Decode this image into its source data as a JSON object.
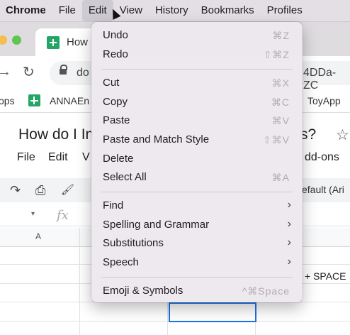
{
  "menubar": {
    "items": [
      "Chrome",
      "File",
      "Edit",
      "View",
      "History",
      "Bookmarks",
      "Profiles"
    ]
  },
  "browser": {
    "tab_title": "How",
    "url_left": "do",
    "url_right": "4DDa-ZC"
  },
  "bookmarks": {
    "items": [
      "ops",
      "ANNAEn",
      "ToyApp"
    ]
  },
  "document": {
    "title_left": "How do I In",
    "title_right": "s?",
    "menu": [
      "File",
      "Edit",
      "V"
    ],
    "menu_right": "dd-ons",
    "font_selector": "efault (Ari",
    "column_a": "A",
    "cell_text": "+ SPACE"
  },
  "edit_menu": {
    "groups": [
      [
        {
          "label": "Undo",
          "shortcut": "⌘Z"
        },
        {
          "label": "Redo",
          "shortcut": "⇧⌘Z"
        }
      ],
      [
        {
          "label": "Cut",
          "shortcut": "⌘X"
        },
        {
          "label": "Copy",
          "shortcut": "⌘C"
        },
        {
          "label": "Paste",
          "shortcut": "⌘V"
        },
        {
          "label": "Paste and Match Style",
          "shortcut": "⇧⌘V"
        },
        {
          "label": "Delete",
          "shortcut": ""
        },
        {
          "label": "Select All",
          "shortcut": "⌘A"
        }
      ],
      [
        {
          "label": "Find",
          "submenu": true
        },
        {
          "label": "Spelling and Grammar",
          "submenu": true
        },
        {
          "label": "Substitutions",
          "submenu": true
        },
        {
          "label": "Speech",
          "submenu": true
        }
      ],
      [
        {
          "label": "Emoji & Symbols",
          "shortcut": "^⌘Space"
        }
      ]
    ]
  },
  "icons": {
    "forward": "→",
    "reload": "↻",
    "star": "☆",
    "redo": "↷",
    "print": "⎙",
    "paint_format": "🖌",
    "submenu_chevron": "›",
    "fx": "fx",
    "caret": "▾"
  },
  "colors": {
    "sheets_green": "#23a566",
    "selection_blue": "#1a73e8",
    "menu_bg": "#ece8ee"
  }
}
